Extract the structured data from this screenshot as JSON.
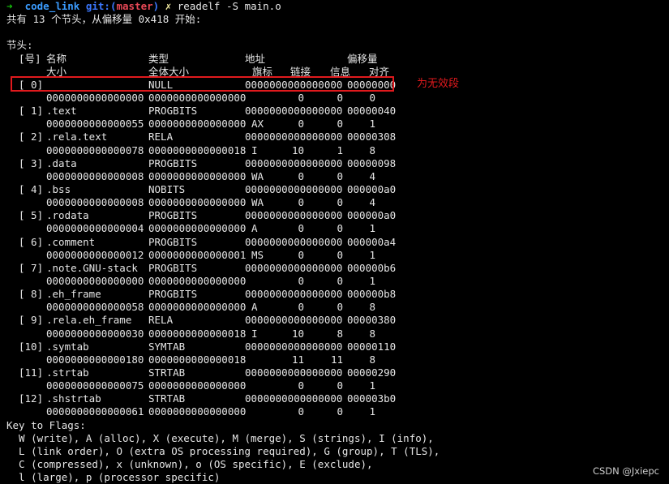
{
  "prompt": {
    "arrow": "➜",
    "dir": "code_link",
    "git_label": "git:(",
    "branch": "master",
    "git_close": ")",
    "dirty": "✗",
    "command": "readelf -S main.o"
  },
  "summary": "共有 13 个节头，从偏移量 0x418 开始:",
  "section_header_title": "节头:",
  "headers": {
    "row1": {
      "idx": "[号]",
      "name": "名称",
      "type": "类型",
      "addr": "地址",
      "off": "偏移量"
    },
    "row2": {
      "size": "大小",
      "entsize": "全体大小",
      "flags": "旗标",
      "link": "链接",
      "info": "信息",
      "align": "对齐"
    }
  },
  "sections": [
    {
      "idx": "[ 0]",
      "name": "",
      "type": "NULL",
      "addr": "0000000000000000",
      "off": "00000000",
      "size": "0000000000000000",
      "entsize": "0000000000000000",
      "flags": "",
      "link": "0",
      "info": "0",
      "align": "0"
    },
    {
      "idx": "[ 1]",
      "name": ".text",
      "type": "PROGBITS",
      "addr": "0000000000000000",
      "off": "00000040",
      "size": "0000000000000055",
      "entsize": "0000000000000000",
      "flags": "AX",
      "link": "0",
      "info": "0",
      "align": "1"
    },
    {
      "idx": "[ 2]",
      "name": ".rela.text",
      "type": "RELA",
      "addr": "0000000000000000",
      "off": "00000308",
      "size": "0000000000000078",
      "entsize": "0000000000000018",
      "flags": "I",
      "link": "10",
      "info": "1",
      "align": "8"
    },
    {
      "idx": "[ 3]",
      "name": ".data",
      "type": "PROGBITS",
      "addr": "0000000000000000",
      "off": "00000098",
      "size": "0000000000000008",
      "entsize": "0000000000000000",
      "flags": "WA",
      "link": "0",
      "info": "0",
      "align": "4"
    },
    {
      "idx": "[ 4]",
      "name": ".bss",
      "type": "NOBITS",
      "addr": "0000000000000000",
      "off": "000000a0",
      "size": "0000000000000008",
      "entsize": "0000000000000000",
      "flags": "WA",
      "link": "0",
      "info": "0",
      "align": "4"
    },
    {
      "idx": "[ 5]",
      "name": ".rodata",
      "type": "PROGBITS",
      "addr": "0000000000000000",
      "off": "000000a0",
      "size": "0000000000000004",
      "entsize": "0000000000000000",
      "flags": "A",
      "link": "0",
      "info": "0",
      "align": "1"
    },
    {
      "idx": "[ 6]",
      "name": ".comment",
      "type": "PROGBITS",
      "addr": "0000000000000000",
      "off": "000000a4",
      "size": "0000000000000012",
      "entsize": "0000000000000001",
      "flags": "MS",
      "link": "0",
      "info": "0",
      "align": "1"
    },
    {
      "idx": "[ 7]",
      "name": ".note.GNU-stack",
      "type": "PROGBITS",
      "addr": "0000000000000000",
      "off": "000000b6",
      "size": "0000000000000000",
      "entsize": "0000000000000000",
      "flags": "",
      "link": "0",
      "info": "0",
      "align": "1"
    },
    {
      "idx": "[ 8]",
      "name": ".eh_frame",
      "type": "PROGBITS",
      "addr": "0000000000000000",
      "off": "000000b8",
      "size": "0000000000000058",
      "entsize": "0000000000000000",
      "flags": "A",
      "link": "0",
      "info": "0",
      "align": "8"
    },
    {
      "idx": "[ 9]",
      "name": ".rela.eh_frame",
      "type": "RELA",
      "addr": "0000000000000000",
      "off": "00000380",
      "size": "0000000000000030",
      "entsize": "0000000000000018",
      "flags": "I",
      "link": "10",
      "info": "8",
      "align": "8"
    },
    {
      "idx": "[10]",
      "name": ".symtab",
      "type": "SYMTAB",
      "addr": "0000000000000000",
      "off": "00000110",
      "size": "0000000000000180",
      "entsize": "0000000000000018",
      "flags": "",
      "link": "11",
      "info": "11",
      "align": "8"
    },
    {
      "idx": "[11]",
      "name": ".strtab",
      "type": "STRTAB",
      "addr": "0000000000000000",
      "off": "00000290",
      "size": "0000000000000075",
      "entsize": "0000000000000000",
      "flags": "",
      "link": "0",
      "info": "0",
      "align": "1"
    },
    {
      "idx": "[12]",
      "name": ".shstrtab",
      "type": "STRTAB",
      "addr": "0000000000000000",
      "off": "000003b0",
      "size": "0000000000000061",
      "entsize": "0000000000000000",
      "flags": "",
      "link": "0",
      "info": "0",
      "align": "1"
    }
  ],
  "key_to_flags": {
    "title": "Key to Flags:",
    "lines": [
      "  W (write), A (alloc), X (execute), M (merge), S (strings), I (info),",
      "  L (link order), O (extra OS processing required), G (group), T (TLS),",
      "  C (compressed), x (unknown), o (OS specific), E (exclude),",
      "  l (large), p (processor specific)"
    ]
  },
  "annotation": "为无效段",
  "watermark": "CSDN @Jxiepc",
  "colors": {
    "background": "#000000",
    "text": "#e6e6e6",
    "prompt_arrow": "#16c60c",
    "prompt_dir": "#3b9cff",
    "branch": "#e74856",
    "highlight": "#e0191d"
  }
}
